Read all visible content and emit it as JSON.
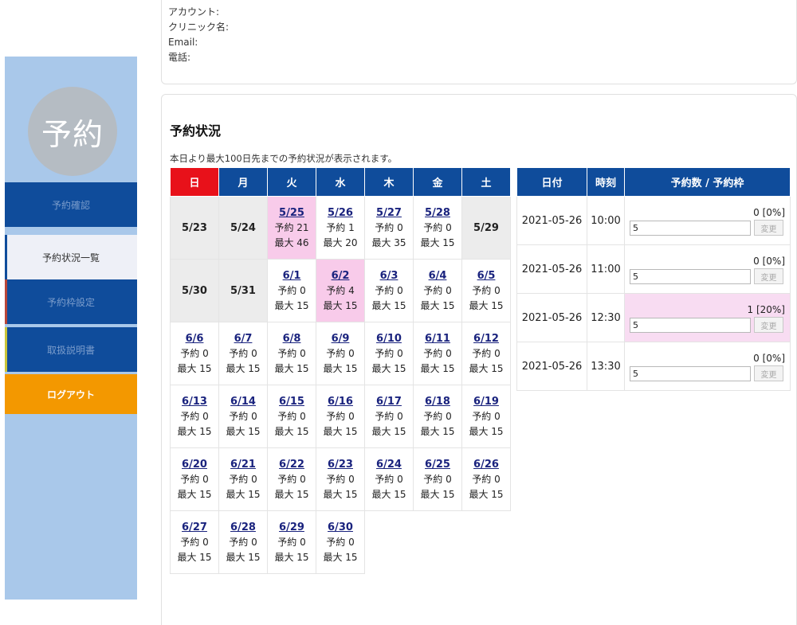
{
  "account": {
    "account_label": "アカウント:",
    "clinic_label": "クリニック名:",
    "email_label": "Email:",
    "phone_label": "電話:"
  },
  "sidebar": {
    "avatar_text": "予約",
    "items": [
      {
        "label": "予約確認"
      },
      {
        "label": "予約状況一覧"
      },
      {
        "label": "予約枠設定"
      },
      {
        "label": "取扱説明書"
      },
      {
        "label": "ログアウト"
      }
    ]
  },
  "main": {
    "title": "予約状況",
    "description": "本日より最大100日先までの予約状況が表示されます。"
  },
  "calendar": {
    "weekdays": [
      "日",
      "月",
      "火",
      "水",
      "木",
      "金",
      "土"
    ],
    "weeks": [
      [
        {
          "date": "5/23",
          "past": true
        },
        {
          "date": "5/24",
          "past": true
        },
        {
          "date": "5/25",
          "reserved": "予約 21",
          "max": "最大 46",
          "highlight": true
        },
        {
          "date": "5/26",
          "reserved": "予約 1",
          "max": "最大 20"
        },
        {
          "date": "5/27",
          "reserved": "予約 0",
          "max": "最大 35"
        },
        {
          "date": "5/28",
          "reserved": "予約 0",
          "max": "最大 15"
        },
        {
          "date": "5/29",
          "past": true
        }
      ],
      [
        {
          "date": "5/30",
          "past": true
        },
        {
          "date": "5/31",
          "past": true
        },
        {
          "date": "6/1",
          "reserved": "予約 0",
          "max": "最大 15"
        },
        {
          "date": "6/2",
          "reserved": "予約 4",
          "max": "最大 15",
          "highlight": true
        },
        {
          "date": "6/3",
          "reserved": "予約 0",
          "max": "最大 15"
        },
        {
          "date": "6/4",
          "reserved": "予約 0",
          "max": "最大 15"
        },
        {
          "date": "6/5",
          "reserved": "予約 0",
          "max": "最大 15"
        }
      ],
      [
        {
          "date": "6/6",
          "reserved": "予約 0",
          "max": "最大 15"
        },
        {
          "date": "6/7",
          "reserved": "予約 0",
          "max": "最大 15"
        },
        {
          "date": "6/8",
          "reserved": "予約 0",
          "max": "最大 15"
        },
        {
          "date": "6/9",
          "reserved": "予約 0",
          "max": "最大 15"
        },
        {
          "date": "6/10",
          "reserved": "予約 0",
          "max": "最大 15"
        },
        {
          "date": "6/11",
          "reserved": "予約 0",
          "max": "最大 15"
        },
        {
          "date": "6/12",
          "reserved": "予約 0",
          "max": "最大 15"
        }
      ],
      [
        {
          "date": "6/13",
          "reserved": "予約 0",
          "max": "最大 15"
        },
        {
          "date": "6/14",
          "reserved": "予約 0",
          "max": "最大 15"
        },
        {
          "date": "6/15",
          "reserved": "予約 0",
          "max": "最大 15"
        },
        {
          "date": "6/16",
          "reserved": "予約 0",
          "max": "最大 15"
        },
        {
          "date": "6/17",
          "reserved": "予約 0",
          "max": "最大 15"
        },
        {
          "date": "6/18",
          "reserved": "予約 0",
          "max": "最大 15"
        },
        {
          "date": "6/19",
          "reserved": "予約 0",
          "max": "最大 15"
        }
      ],
      [
        {
          "date": "6/20",
          "reserved": "予約 0",
          "max": "最大 15"
        },
        {
          "date": "6/21",
          "reserved": "予約 0",
          "max": "最大 15"
        },
        {
          "date": "6/22",
          "reserved": "予約 0",
          "max": "最大 15"
        },
        {
          "date": "6/23",
          "reserved": "予約 0",
          "max": "最大 15"
        },
        {
          "date": "6/24",
          "reserved": "予約 0",
          "max": "最大 15"
        },
        {
          "date": "6/25",
          "reserved": "予約 0",
          "max": "最大 15"
        },
        {
          "date": "6/26",
          "reserved": "予約 0",
          "max": "最大 15"
        }
      ],
      [
        {
          "date": "6/27",
          "reserved": "予約 0",
          "max": "最大 15"
        },
        {
          "date": "6/28",
          "reserved": "予約 0",
          "max": "最大 15"
        },
        {
          "date": "6/29",
          "reserved": "予約 0",
          "max": "最大 15"
        },
        {
          "date": "6/30",
          "reserved": "予約 0",
          "max": "最大 15"
        }
      ]
    ]
  },
  "slots": {
    "headers": [
      "日付",
      "時刻",
      "予約数 / 予約枠"
    ],
    "change_label": "変更",
    "rows": [
      {
        "date": "2021-05-26",
        "time": "10:00",
        "count": "0",
        "percent": "[0%]",
        "value": "5",
        "highlight": false
      },
      {
        "date": "2021-05-26",
        "time": "11:00",
        "count": "0",
        "percent": "[0%]",
        "value": "5",
        "highlight": false
      },
      {
        "date": "2021-05-26",
        "time": "12:30",
        "count": "1",
        "percent": "[20%]",
        "value": "5",
        "highlight": true
      },
      {
        "date": "2021-05-26",
        "time": "13:30",
        "count": "0",
        "percent": "[0%]",
        "value": "5",
        "highlight": false
      }
    ]
  },
  "colors": {
    "navy": "#0f4c9b",
    "sunday_red": "#e8111a",
    "sidebar_bg": "#a9c8ea",
    "logout_orange": "#f39800",
    "highlight_pink": "#f8cbea",
    "past_gray": "#ececec"
  }
}
